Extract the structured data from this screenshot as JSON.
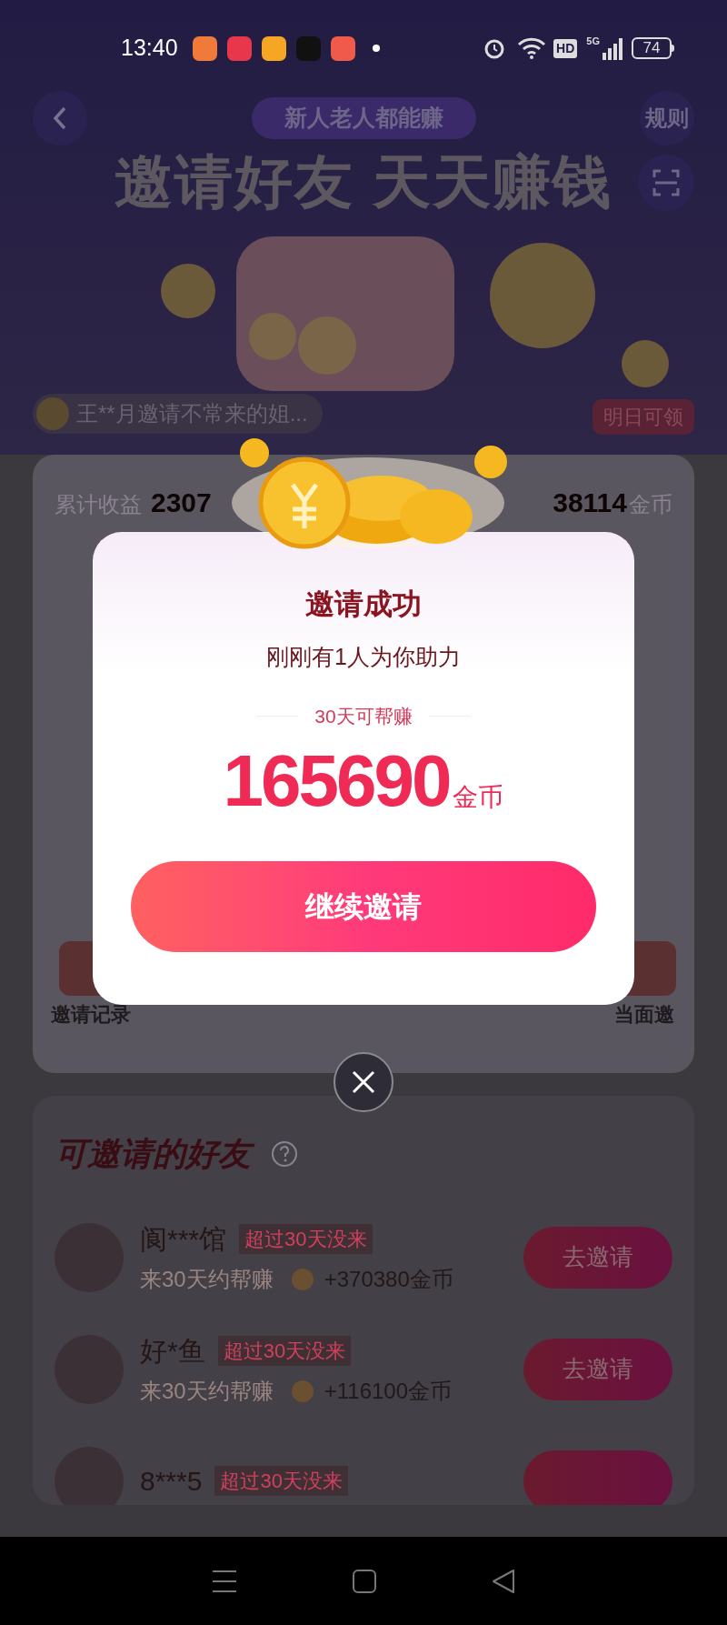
{
  "status_bar": {
    "time": "13:40",
    "hd": "HD",
    "network": "5G",
    "battery": "74"
  },
  "header": {
    "pill": "新人老人都能赚",
    "rules": "规则",
    "title": "邀请好友 天天赚钱"
  },
  "ticker": {
    "text": "王**月邀请不常来的姐...",
    "badge": "明日可领"
  },
  "earnings": {
    "label": "累计收益",
    "value": "2307",
    "coins": "38114",
    "unit": "金币"
  },
  "shortcuts": [
    "邀请记录",
    "当面邀"
  ],
  "popup": {
    "title": "邀请成功",
    "subtitle": "刚刚有1人为你助力",
    "caption": "30天可帮赚",
    "amount": "165690",
    "unit": "金币",
    "button": "继续邀请"
  },
  "friends": {
    "title": "可邀请的好友",
    "items": [
      {
        "name": "阆***馆",
        "tag": "超过30天没来",
        "note": "来30天约帮赚",
        "reward": "+370380金币",
        "button": "去邀请"
      },
      {
        "name": "好*鱼",
        "tag": "超过30天没来",
        "note": "来30天约帮赚",
        "reward": "+116100金币",
        "button": "去邀请"
      },
      {
        "name": "8***5",
        "tag": "超过30天没来"
      }
    ]
  }
}
